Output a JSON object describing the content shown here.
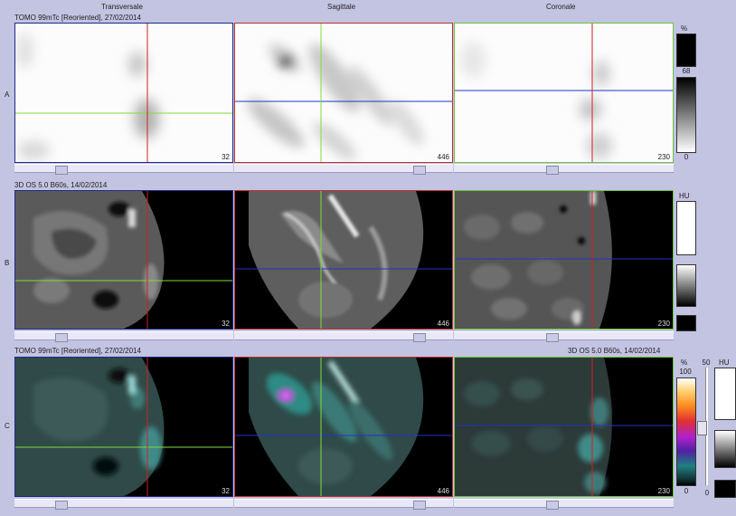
{
  "columns": {
    "transversale": "Transversale",
    "sagittale": "Sagittale",
    "coronale": "Coronale"
  },
  "rows": {
    "a": {
      "letter": "A",
      "header_left": "TOMO 99mTc [Reoriented], 27/02/2014",
      "scale_unit": "%",
      "scale_max": "68",
      "scale_min": "0",
      "slices": [
        "32",
        "446",
        "230"
      ]
    },
    "b": {
      "letter": "B",
      "header_left": "3D  OS  5.0  B60s, 14/02/2014",
      "scale_unit": "HU",
      "slices": [
        "32",
        "446",
        "230"
      ]
    },
    "c": {
      "letter": "C",
      "header_left": "TOMO 99mTc [Reoriented], 27/02/2014",
      "header_right": "3D  OS  5.0  B60s, 14/02/2014",
      "scale_unit": "%",
      "scale_max": "100",
      "scale_min": "0",
      "opacity_max": "50",
      "opacity_min": "0",
      "ct_unit": "HU",
      "slices": [
        "32",
        "446",
        "230"
      ]
    }
  },
  "colors": {
    "background": "#c3c3e2",
    "crosshair_green": "#7fdc3a",
    "crosshair_red": "#d42020",
    "crosshair_blue": "#2233cc",
    "frame_blue": "#1e2a8a",
    "frame_red": "#c0302e",
    "frame_green": "#6ac83a"
  }
}
